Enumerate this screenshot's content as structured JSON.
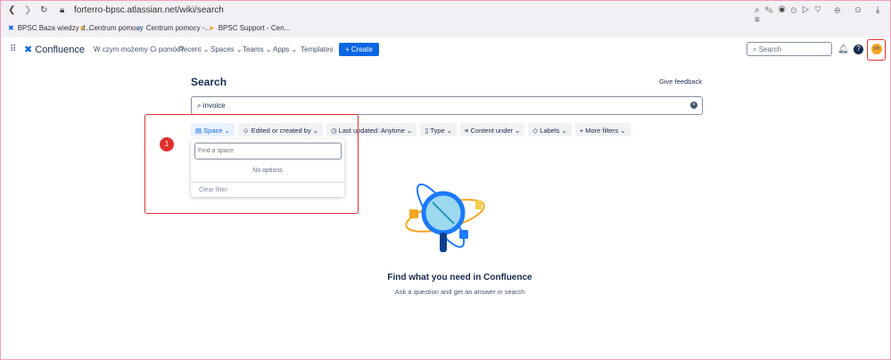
{
  "browser": {
    "url": "forterro-bpsc.atlassian.net/wiki/search",
    "bookmarks": [
      "BPSC Baza wiedzy d...",
      "Centrum pomocy",
      "Centrum pomocy -...",
      "BPSC Support - Cen..."
    ]
  },
  "nav": {
    "logo": "Confluence",
    "help_link": "W czym możemy Ci pomóc?",
    "items": [
      "Recent",
      "Spaces",
      "Teams",
      "Apps",
      "Templates"
    ],
    "create": "+ Create",
    "search_placeholder": "Search",
    "avatar": "KB"
  },
  "page": {
    "title": "Search",
    "feedback": "Give feedback",
    "query": "invoice",
    "filters": [
      "Space",
      "Edited or created by",
      "Last updated: Anytime",
      "Type",
      "Content under",
      "Labels",
      "More filters"
    ],
    "dropdown": {
      "placeholder": "Find a space",
      "empty": "No options",
      "clear": "Clear filter"
    },
    "annotation": "1",
    "empty_title": "Find what you need in Confluence",
    "empty_sub": "Ask a question and get an answer in search"
  }
}
